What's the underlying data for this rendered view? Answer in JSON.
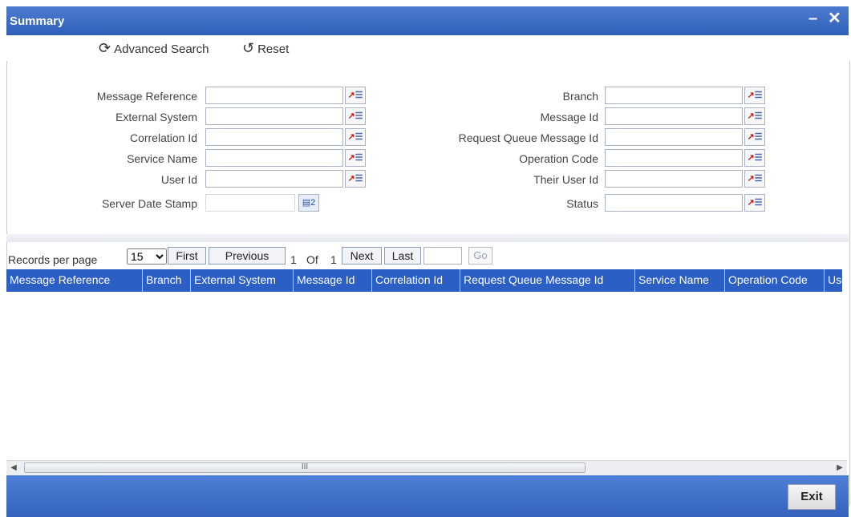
{
  "window": {
    "title": "Summary",
    "minimize": "–",
    "close": "✕"
  },
  "toolbar": {
    "advanced_search": "Advanced Search",
    "reset": "Reset"
  },
  "form": {
    "left": [
      {
        "label": "Message Reference",
        "value": ""
      },
      {
        "label": "External System",
        "value": ""
      },
      {
        "label": "Correlation Id",
        "value": ""
      },
      {
        "label": "Service Name",
        "value": ""
      },
      {
        "label": "User Id",
        "value": ""
      },
      {
        "label": "Server Date Stamp",
        "value": ""
      }
    ],
    "right": [
      {
        "label": "Branch",
        "value": ""
      },
      {
        "label": "Message Id",
        "value": ""
      },
      {
        "label": "Request Queue Message Id",
        "value": ""
      },
      {
        "label": "Operation Code",
        "value": ""
      },
      {
        "label": "Their User Id",
        "value": ""
      },
      {
        "label": "Status",
        "value": ""
      }
    ]
  },
  "pager": {
    "records_label": "Records per page",
    "records_value": "15",
    "first": "First",
    "previous": "Previous",
    "page": "1",
    "of": "Of",
    "total": "1",
    "next": "Next",
    "last": "Last",
    "go": "Go"
  },
  "table": {
    "columns": [
      "Message Reference",
      "Branch",
      "External System",
      "Message Id",
      "Correlation Id",
      "Request Queue Message Id",
      "Service Name",
      "Operation Code",
      "User Id"
    ],
    "rows": []
  },
  "scrollbar": {
    "grip": "III"
  },
  "footer": {
    "exit": "Exit"
  },
  "colors": {
    "title_bar": "#3a67c2",
    "header_row": "#2c5fc4",
    "footer": "#3a67c2"
  }
}
